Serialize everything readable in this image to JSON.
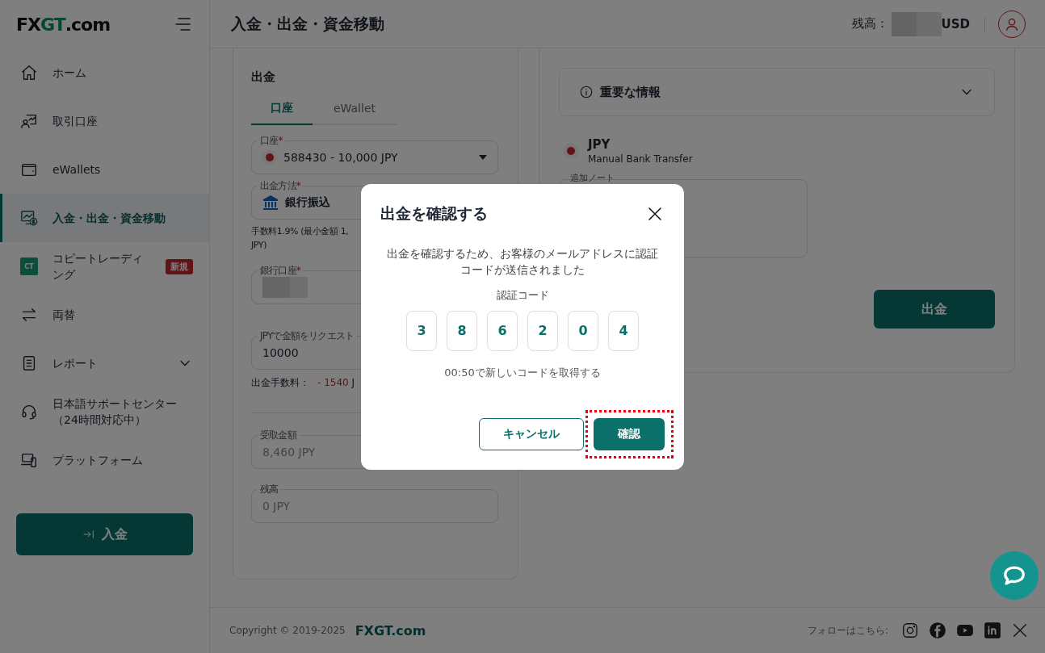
{
  "brand": {
    "logo_main": "FX",
    "logo_accent": "GT",
    "logo_suffix": ".com"
  },
  "sidebar": {
    "items": [
      {
        "label": "ホーム",
        "selected": false
      },
      {
        "label": "取引口座",
        "selected": false
      },
      {
        "label": "eWallets",
        "selected": false
      },
      {
        "label": "入金・出金・資金移動",
        "selected": true
      },
      {
        "label": "コピートレーディング",
        "selected": false,
        "icon_text": "CT",
        "badge": "新規"
      },
      {
        "label": "両替",
        "selected": false
      },
      {
        "label": "レポート",
        "selected": false,
        "expanded": false
      },
      {
        "label": "日本語サポートセンター（24時間対応中）",
        "selected": false
      },
      {
        "label": "プラットフォーム",
        "selected": false
      }
    ],
    "deposit_button": "入金"
  },
  "header": {
    "title": "入金・出金・資金移動",
    "balance_label": "残高：",
    "balance_currency": "USD"
  },
  "withdraw_form": {
    "title": "出金",
    "tabs": [
      {
        "label": "口座",
        "selected": true
      },
      {
        "label": "eWallet",
        "selected": false
      }
    ],
    "account": {
      "label": "口座",
      "required_mark": "*",
      "value": "588430 - 10,000 JPY"
    },
    "method": {
      "label": "出金方法",
      "required_mark": "*",
      "value": "銀行振込"
    },
    "fee_note": [
      "手数料1.9% (最小金額 1,",
      "JPY)"
    ],
    "bank_account": {
      "label": "銀行口座",
      "required_mark": "*"
    },
    "amount": {
      "label": "JPYで金額をリクエスト",
      "value": "10000"
    },
    "fee": {
      "label": "出金手数料：",
      "value": "- 1540",
      "unit": "J"
    },
    "received": {
      "label": "受取金額",
      "value": "8,460 JPY"
    },
    "balance": {
      "label": "残高",
      "value": "0 JPY"
    }
  },
  "info_panel": {
    "accordion": {
      "title": "重要な情報",
      "expanded": false
    },
    "currency": {
      "code": "JPY",
      "method": "Manual Bank Transfer"
    },
    "note_label": "追加ノート",
    "submit_button": "出金"
  },
  "modal": {
    "title": "出金を確認する",
    "message": "出金を確認するため、お客様のメールアドレスに認証コードが送信されました",
    "code_label": "認証コード",
    "digits": [
      "3",
      "8",
      "6",
      "2",
      "0",
      "4"
    ],
    "resend": "00:50で新しいコードを取得する",
    "cancel_button": "キャンセル",
    "confirm_button": "確認",
    "confirm_highlighted": true
  },
  "footer": {
    "copyright": "Copyright © 2019-2025",
    "brand": "FXGT.com",
    "follow_label": "フォローはこちら:"
  }
}
